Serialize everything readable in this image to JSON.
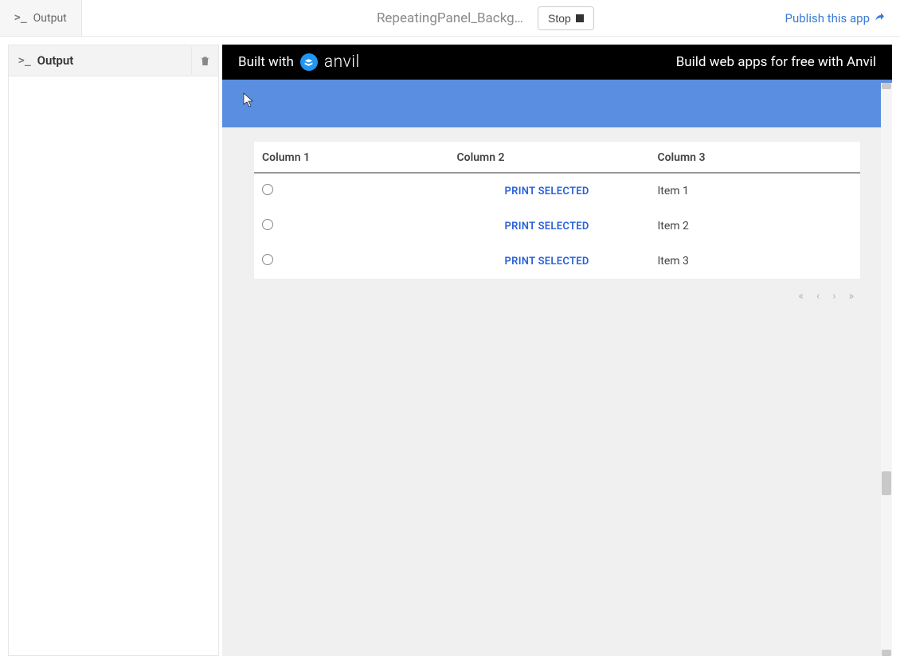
{
  "tab": {
    "label": "Output"
  },
  "toolbar": {
    "app_title": "RepeatingPanel_Backg…",
    "stop_label": "Stop",
    "publish_label": "Publish this app"
  },
  "output_panel": {
    "title": "Output"
  },
  "anvil_banner": {
    "built_with": "Built with",
    "brand": "anvil",
    "tagline": "Build web apps for free with Anvil"
  },
  "table": {
    "columns": [
      "Column 1",
      "Column 2",
      "Column 3"
    ],
    "rows": [
      {
        "action": "PRINT SELECTED",
        "item": "Item 1"
      },
      {
        "action": "PRINT SELECTED",
        "item": "Item 2"
      },
      {
        "action": "PRINT SELECTED",
        "item": "Item 3"
      }
    ]
  }
}
